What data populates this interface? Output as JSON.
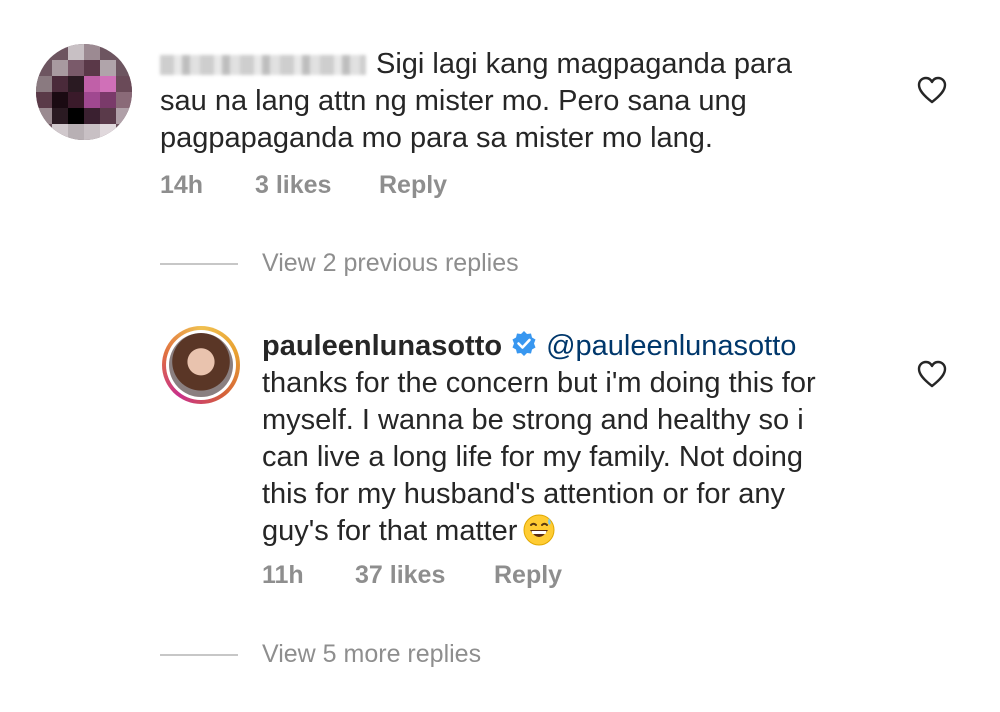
{
  "comment1": {
    "text_line1": "Sigi lagi kang magpaganda para",
    "text_line2": "sau na lang attn ng mister mo. Pero sana ung",
    "text_line3": "pagpapaganda mo para sa mister mo lang.",
    "time": "14h",
    "likes": "3 likes",
    "reply": "Reply"
  },
  "view_previous": "View 2 previous replies",
  "comment2": {
    "username": "pauleenlunasotto",
    "mention": "@pauleenlunasotto",
    "text_line1": "thanks for the concern but i'm doing this for",
    "text_line2": "myself. I wanna be strong and healthy so i",
    "text_line3": "can live a long life for my family. Not doing",
    "text_line4": "this for my husband's attention or for any",
    "text_line5": "guy's for that matter",
    "time": "11h",
    "likes": "37 likes",
    "reply": "Reply"
  },
  "view_more": "View 5 more replies",
  "colors": {
    "text": "#262626",
    "muted": "#8e8e8e",
    "mention": "#00376b",
    "verified": "#3897f0"
  }
}
